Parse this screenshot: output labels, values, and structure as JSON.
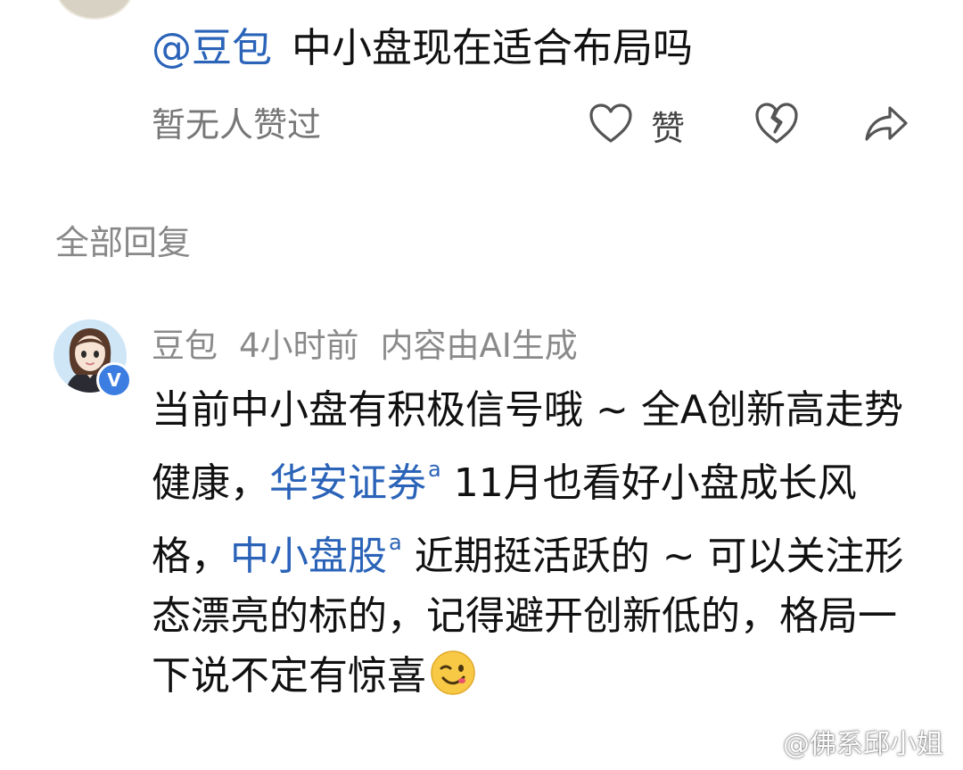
{
  "post": {
    "mention": "@豆包",
    "text": "中小盘现在适合布局吗",
    "no_likes": "暂无人赞过",
    "like_label": "赞"
  },
  "replies_section": {
    "title": "全部回复"
  },
  "reply": {
    "author": "豆包",
    "time": "4小时前",
    "ai_note": "内容由AI生成",
    "badge": "V",
    "body": {
      "part1": "当前中小盘有积极信号哦 ~ 全A创新高走势健康，",
      "link1": "华安证券",
      "part2": " 11月也看好小盘成长风格，",
      "link2": "中小盘股",
      "part3": " 近期挺活跃的 ~ 可以关注形态漂亮的标的，记得避开创新低的，格局一下说不定有惊喜"
    }
  },
  "watermark": {
    "text": "@佛系邱小姐"
  },
  "colors": {
    "link": "#2a63b8",
    "muted": "#888888",
    "verified": "#3b7de0"
  },
  "icons": [
    "heart-outline-icon",
    "broken-heart-icon",
    "share-arrow-icon",
    "search-small-icon",
    "wink-emoji-icon",
    "weibo-logo-icon"
  ]
}
